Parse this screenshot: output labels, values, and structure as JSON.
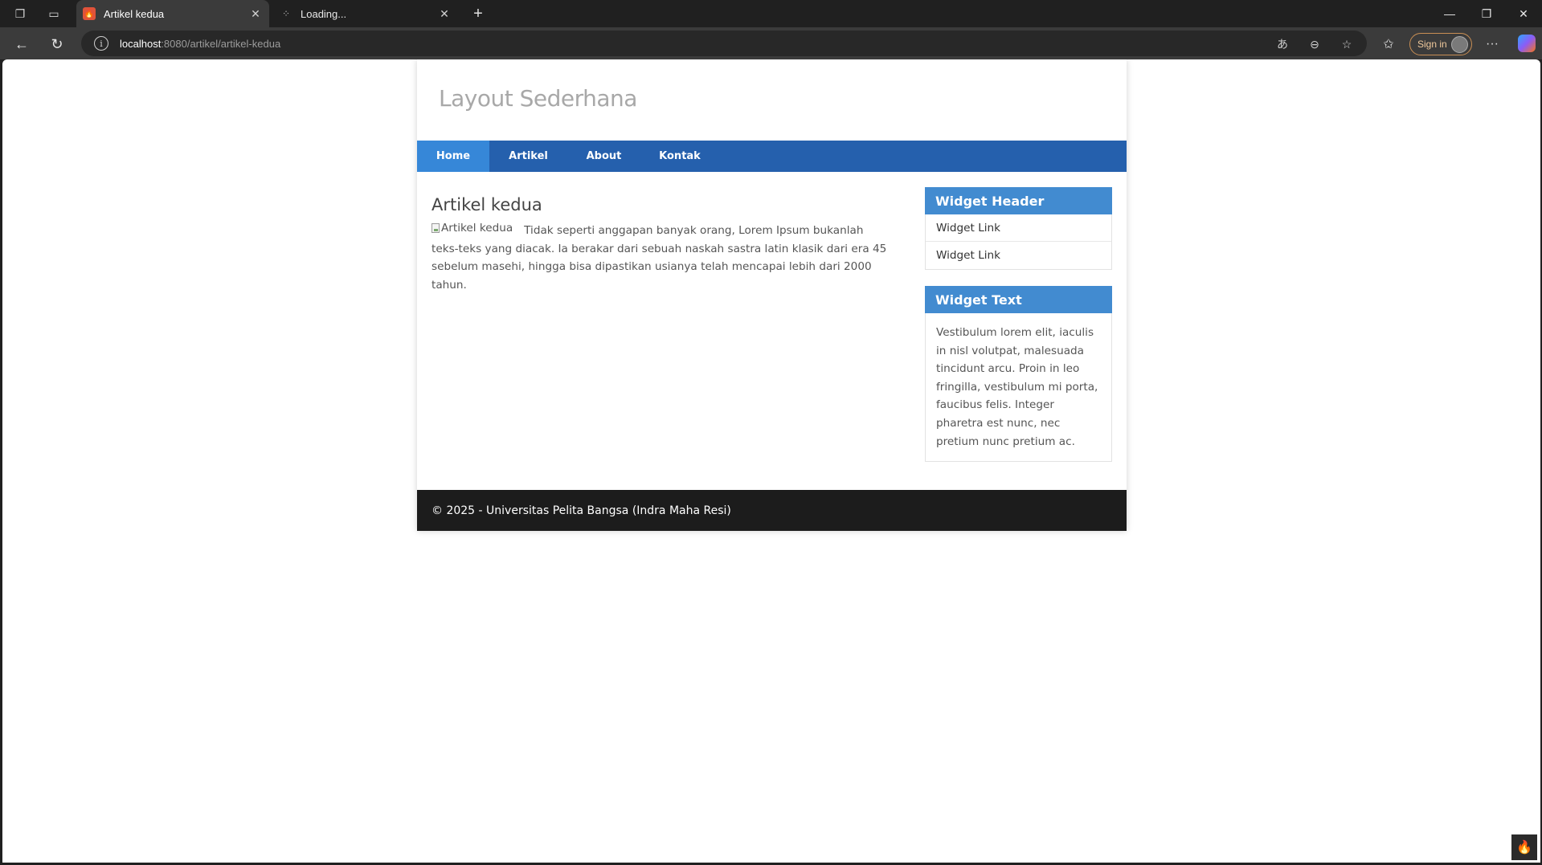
{
  "browser": {
    "tabs": [
      {
        "title": "Artikel kedua",
        "active": true
      },
      {
        "title": "Loading...",
        "active": false
      }
    ],
    "url_host": "localhost",
    "url_path": ":8080/artikel/artikel-kedua",
    "signin_label": "Sign in"
  },
  "site": {
    "title": "Layout Sederhana",
    "nav": [
      "Home",
      "Artikel",
      "About",
      "Kontak"
    ],
    "active_nav": "Home"
  },
  "article": {
    "title": "Artikel kedua",
    "image_alt": "Artikel kedua",
    "body": "Tidak seperti anggapan banyak orang, Lorem Ipsum bukanlah teks-teks yang diacak. Ia berakar dari sebuah naskah sastra latin klasik dari era 45 sebelum masehi, hingga bisa dipastikan usianya telah mencapai lebih dari 2000 tahun."
  },
  "sidebar": {
    "widget_links": {
      "header": "Widget Header",
      "links": [
        "Widget Link",
        "Widget Link"
      ]
    },
    "widget_text": {
      "header": "Widget Text",
      "text": "Vestibulum lorem elit, iaculis in nisl volutpat, malesuada tincidunt arcu. Proin in leo fringilla, vestibulum mi porta, faucibus felis. Integer pharetra est nunc, nec pretium nunc pretium ac."
    }
  },
  "footer": {
    "text": "© 2025 - Universitas Pelita Bangsa (Indra Maha Resi)"
  },
  "colors": {
    "nav_bg": "#2560ad",
    "nav_active": "#3687d8",
    "widget_header": "#428bd0",
    "footer_bg": "#1c1c1c"
  }
}
